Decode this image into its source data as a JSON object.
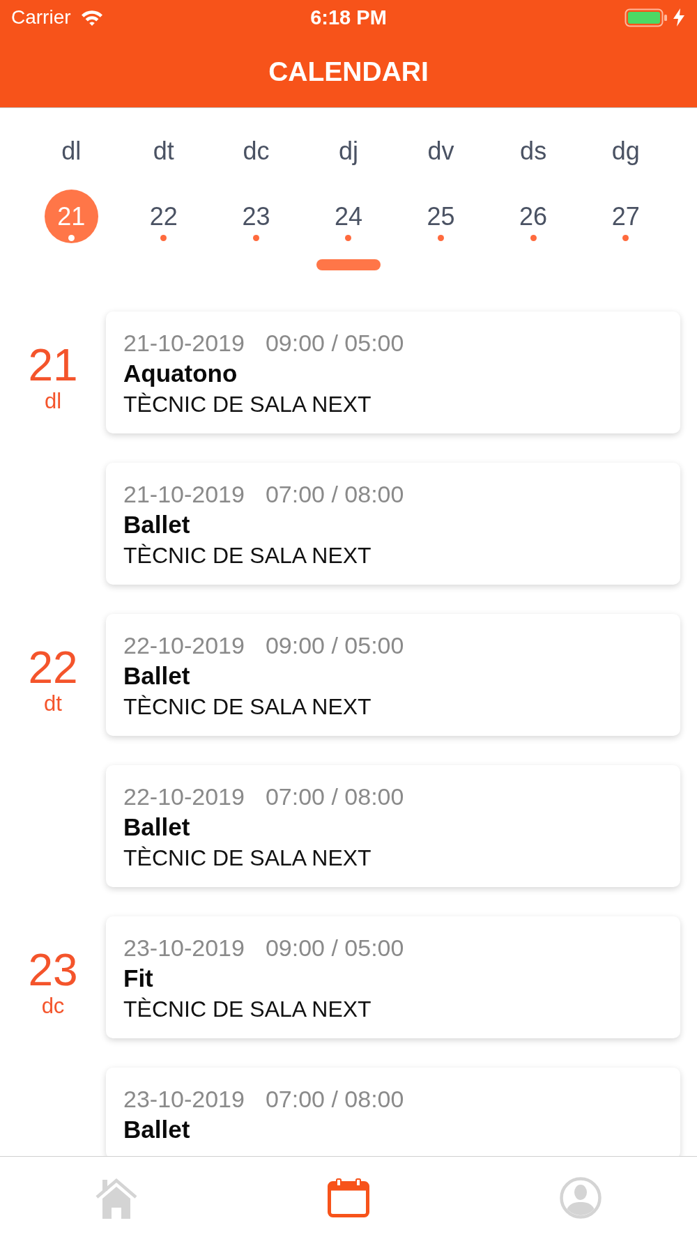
{
  "status_bar": {
    "carrier": "Carrier",
    "time": "6:18 PM"
  },
  "header": {
    "title": "CALENDARI"
  },
  "week": {
    "days": [
      {
        "weekday": "dl",
        "date": "21",
        "selected": true,
        "has_events": true
      },
      {
        "weekday": "dt",
        "date": "22",
        "selected": false,
        "has_events": true
      },
      {
        "weekday": "dc",
        "date": "23",
        "selected": false,
        "has_events": true
      },
      {
        "weekday": "dj",
        "date": "24",
        "selected": false,
        "has_events": true
      },
      {
        "weekday": "dv",
        "date": "25",
        "selected": false,
        "has_events": true
      },
      {
        "weekday": "ds",
        "date": "26",
        "selected": false,
        "has_events": true
      },
      {
        "weekday": "dg",
        "date": "27",
        "selected": false,
        "has_events": true
      }
    ]
  },
  "agenda": [
    {
      "day": "21",
      "weekday": "dl",
      "events": [
        {
          "date": "21-10-2019",
          "time": "09:00 / 05:00",
          "title": "Aquatono",
          "role": "TÈCNIC DE SALA NEXT"
        },
        {
          "date": "21-10-2019",
          "time": "07:00 / 08:00",
          "title": "Ballet",
          "role": "TÈCNIC DE SALA NEXT"
        }
      ]
    },
    {
      "day": "22",
      "weekday": "dt",
      "events": [
        {
          "date": "22-10-2019",
          "time": "09:00 / 05:00",
          "title": "Ballet",
          "role": "TÈCNIC DE SALA NEXT"
        },
        {
          "date": "22-10-2019",
          "time": "07:00 / 08:00",
          "title": "Ballet",
          "role": "TÈCNIC DE SALA NEXT"
        }
      ]
    },
    {
      "day": "23",
      "weekday": "dc",
      "events": [
        {
          "date": "23-10-2019",
          "time": "09:00 / 05:00",
          "title": "Fit",
          "role": "TÈCNIC DE SALA NEXT"
        },
        {
          "date": "23-10-2019",
          "time": "07:00 / 08:00",
          "title": "Ballet"
        }
      ]
    }
  ],
  "tab_bar": [
    {
      "kind": "home",
      "selected": false
    },
    {
      "kind": "calendar",
      "selected": true
    },
    {
      "kind": "profile",
      "selected": false
    }
  ]
}
